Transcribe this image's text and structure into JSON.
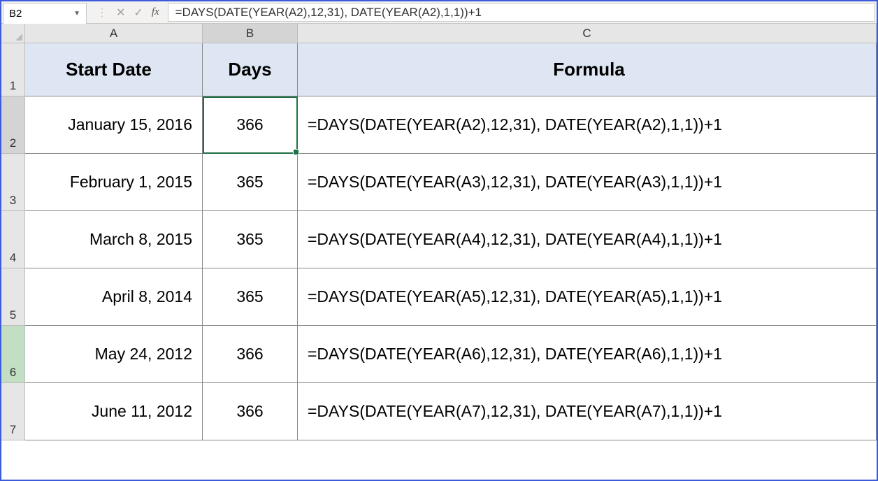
{
  "nameBox": "B2",
  "formula": "=DAYS(DATE(YEAR(A2),12,31), DATE(YEAR(A2),1,1))+1",
  "fxLabel": "fx",
  "columns": [
    "A",
    "B",
    "C"
  ],
  "colWidths": {
    "A": 254,
    "B": 136,
    "C": 828
  },
  "rowNumbers": [
    "1",
    "2",
    "3",
    "4",
    "5",
    "6",
    "7"
  ],
  "rowHeights": {
    "1": 76,
    "2": 82,
    "3": 82,
    "4": 82,
    "5": 82,
    "6": 82,
    "7": 82
  },
  "tableHeaders": {
    "A": "Start Date",
    "B": "Days",
    "C": "Formula"
  },
  "rows": [
    {
      "date": "January 15, 2016",
      "days": "366",
      "formula": "=DAYS(DATE(YEAR(A2),12,31), DATE(YEAR(A2),1,1))+1"
    },
    {
      "date": "February 1, 2015",
      "days": "365",
      "formula": "=DAYS(DATE(YEAR(A3),12,31), DATE(YEAR(A3),1,1))+1"
    },
    {
      "date": "March 8, 2015",
      "days": "365",
      "formula": "=DAYS(DATE(YEAR(A4),12,31), DATE(YEAR(A4),1,1))+1"
    },
    {
      "date": "April 8, 2014",
      "days": "365",
      "formula": "=DAYS(DATE(YEAR(A5),12,31), DATE(YEAR(A5),1,1))+1"
    },
    {
      "date": "May 24, 2012",
      "days": "366",
      "formula": "=DAYS(DATE(YEAR(A6),12,31), DATE(YEAR(A6),1,1))+1"
    },
    {
      "date": "June 11, 2012",
      "days": "366",
      "formula": "=DAYS(DATE(YEAR(A7),12,31), DATE(YEAR(A7),1,1))+1"
    }
  ],
  "activeCell": {
    "row": 2,
    "col": "B"
  },
  "greenRowHeader": 6
}
